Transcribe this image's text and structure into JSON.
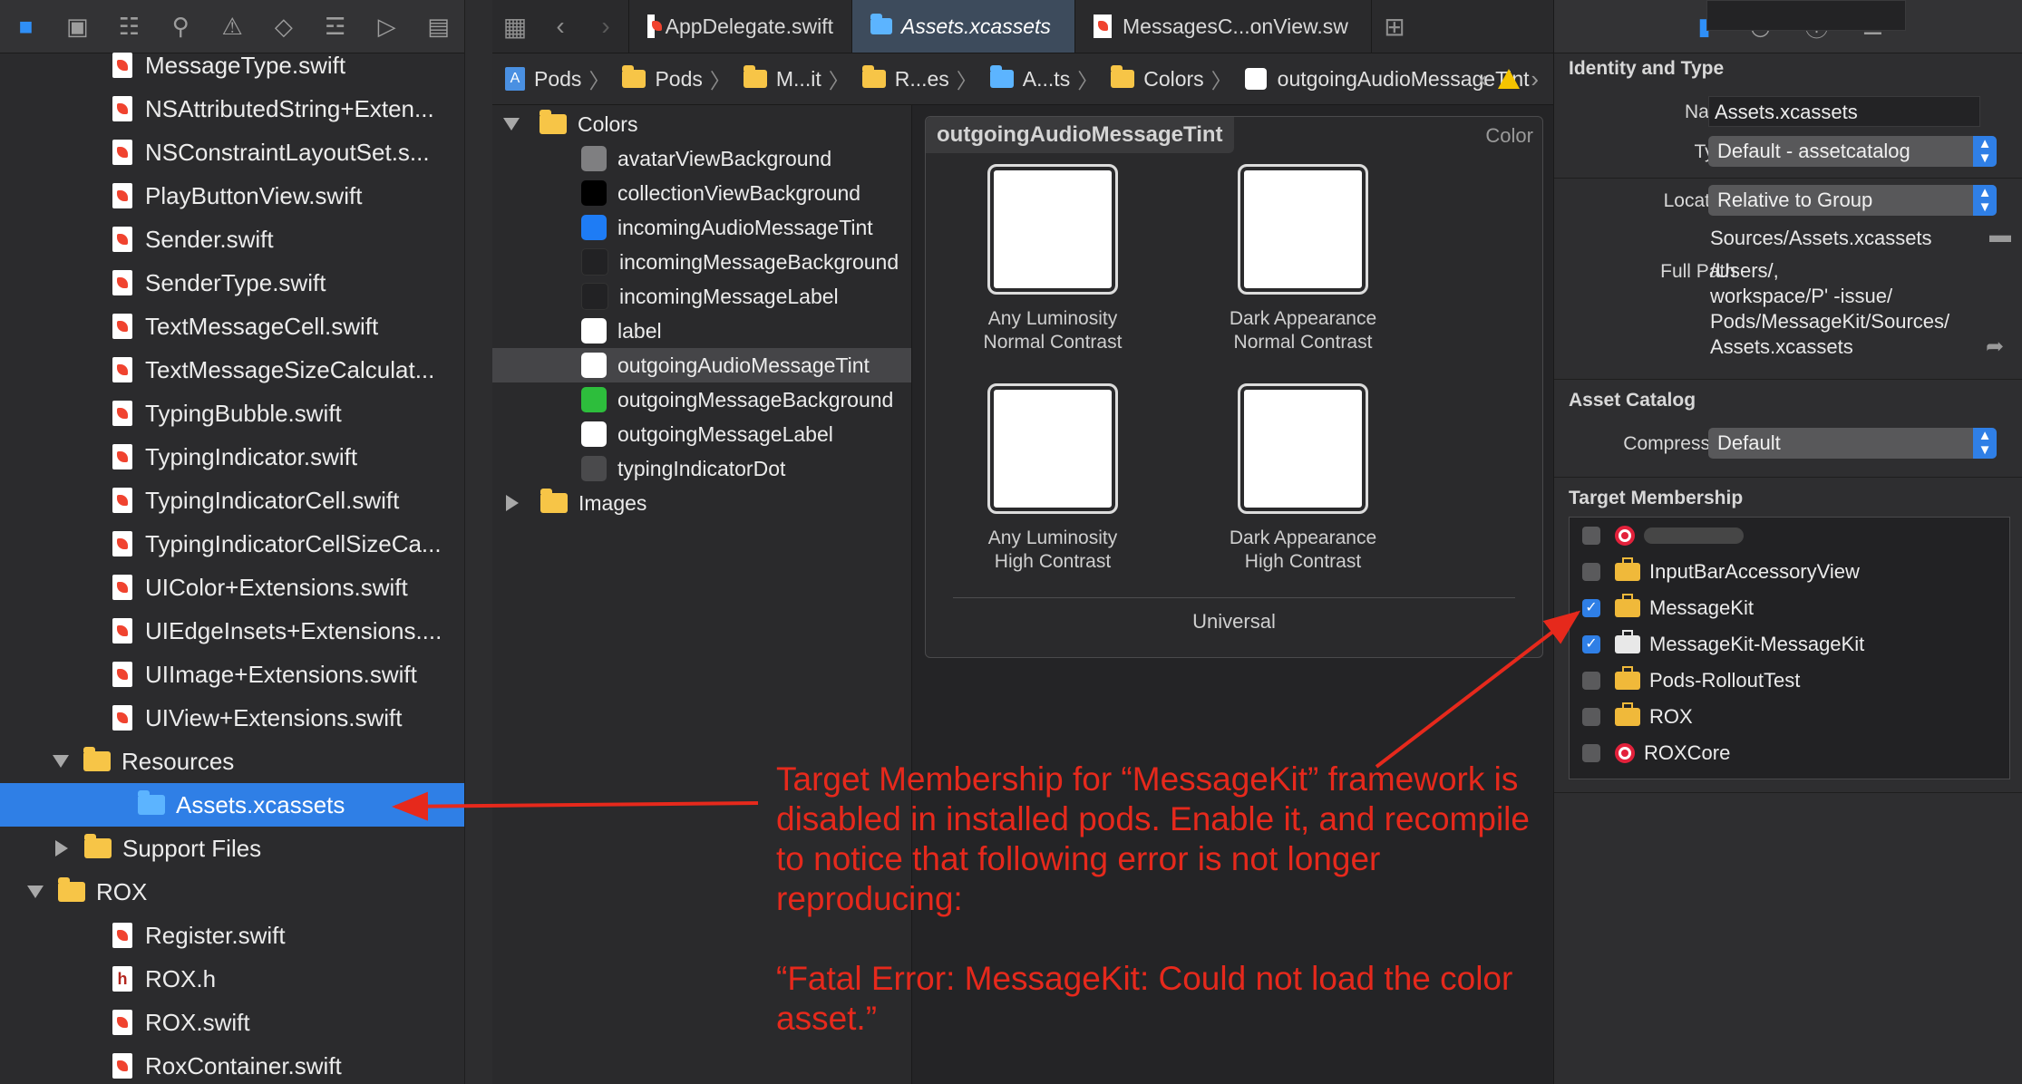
{
  "navigator": {
    "toolbar_icons": [
      "folder-icon",
      "source-control-icon",
      "symbol-icon",
      "find-icon",
      "issue-icon",
      "test-icon",
      "debug-icon",
      "breakpoint-icon",
      "report-icon"
    ],
    "items": [
      {
        "label": "MessageType.swift",
        "kind": "swift",
        "indent": 1
      },
      {
        "label": "NSAttributedString+Exten...",
        "kind": "swift",
        "indent": 1
      },
      {
        "label": "NSConstraintLayoutSet.s...",
        "kind": "swift",
        "indent": 1
      },
      {
        "label": "PlayButtonView.swift",
        "kind": "swift",
        "indent": 1
      },
      {
        "label": "Sender.swift",
        "kind": "swift",
        "indent": 1
      },
      {
        "label": "SenderType.swift",
        "kind": "swift",
        "indent": 1
      },
      {
        "label": "TextMessageCell.swift",
        "kind": "swift",
        "indent": 1
      },
      {
        "label": "TextMessageSizeCalculat...",
        "kind": "swift",
        "indent": 1
      },
      {
        "label": "TypingBubble.swift",
        "kind": "swift",
        "indent": 1
      },
      {
        "label": "TypingIndicator.swift",
        "kind": "swift",
        "indent": 1
      },
      {
        "label": "TypingIndicatorCell.swift",
        "kind": "swift",
        "indent": 1
      },
      {
        "label": "TypingIndicatorCellSizeCa...",
        "kind": "swift",
        "indent": 1
      },
      {
        "label": "UIColor+Extensions.swift",
        "kind": "swift",
        "indent": 1
      },
      {
        "label": "UIEdgeInsets+Extensions....",
        "kind": "swift",
        "indent": 1
      },
      {
        "label": "UIImage+Extensions.swift",
        "kind": "swift",
        "indent": 1
      },
      {
        "label": "UIView+Extensions.swift",
        "kind": "swift",
        "indent": 1
      },
      {
        "label": "Resources",
        "kind": "folder-open",
        "indent": 0
      },
      {
        "label": "Assets.xcassets",
        "kind": "assets",
        "indent": 2,
        "selected": true
      },
      {
        "label": "Support Files",
        "kind": "folder-closed",
        "indent": 0
      },
      {
        "label": "ROX",
        "kind": "folder-open",
        "indent": -1
      },
      {
        "label": "Register.swift",
        "kind": "swift",
        "indent": 1
      },
      {
        "label": "ROX.h",
        "kind": "header",
        "indent": 1
      },
      {
        "label": "ROX.swift",
        "kind": "swift",
        "indent": 1
      },
      {
        "label": "RoxContainer.swift",
        "kind": "swift",
        "indent": 1
      }
    ]
  },
  "editor": {
    "tabs": [
      {
        "label": "AppDelegate.swift",
        "active": false
      },
      {
        "label": "Assets.xcassets",
        "active": true
      },
      {
        "label": "MessagesC...onView.sw",
        "active": false
      }
    ],
    "breadcrumbs": [
      "Pods",
      "Pods",
      "M...it",
      "R...es",
      "A...ts",
      "Colors",
      "outgoingAudioMessageTint"
    ]
  },
  "asset_outline": {
    "colors_folder": "Colors",
    "images_folder": "Images",
    "colors": [
      {
        "name": "avatarViewBackground",
        "swatch": "#7f7f81"
      },
      {
        "name": "collectionViewBackground",
        "swatch": "#000000"
      },
      {
        "name": "incomingAudioMessageTint",
        "swatch": "#1e7cf5"
      },
      {
        "name": "incomingMessageBackground",
        "swatch": "#222224"
      },
      {
        "name": "incomingMessageLabel",
        "swatch": "#222224"
      },
      {
        "name": "label",
        "swatch": "#ffffff"
      },
      {
        "name": "outgoingAudioMessageTint",
        "swatch": "#ffffff",
        "selected": true
      },
      {
        "name": "outgoingMessageBackground",
        "swatch": "#2dbe3c"
      },
      {
        "name": "outgoingMessageLabel",
        "swatch": "#ffffff"
      },
      {
        "name": "typingIndicatorDot",
        "swatch": "#4a4a4c"
      }
    ]
  },
  "canvas": {
    "color_set_name": "outgoingAudioMessageTint",
    "color_set_type": "Color",
    "wells": [
      {
        "line1": "Any Luminosity",
        "line2": "Normal Contrast"
      },
      {
        "line1": "Dark Appearance",
        "line2": "Normal Contrast"
      },
      {
        "line1": "Any Luminosity",
        "line2": "High Contrast"
      },
      {
        "line1": "Dark Appearance",
        "line2": "High Contrast"
      }
    ],
    "universal_label": "Universal"
  },
  "inspector": {
    "identity_title": "Identity and Type",
    "name_label": "Name",
    "name_value": "Assets.xcassets",
    "type_label": "Type",
    "type_value": "Default - assetcatalog",
    "location_label": "Location",
    "location_value": "Relative to Group",
    "location_path": "Sources/Assets.xcassets",
    "fullpath_label": "Full Path",
    "fullpath_lines": [
      "/Users/,",
      "workspace/P'         -issue/",
      "Pods/MessageKit/Sources/",
      "Assets.xcassets"
    ],
    "asset_catalog_title": "Asset Catalog",
    "compression_label": "Compression",
    "compression_value": "Default",
    "membership_title": "Target Membership",
    "targets": [
      {
        "name": "",
        "icon": "target",
        "checked": false,
        "blurred": true
      },
      {
        "name": "InputBarAccessoryView",
        "icon": "toolbox",
        "checked": false
      },
      {
        "name": "MessageKit",
        "icon": "toolbox",
        "checked": true
      },
      {
        "name": "MessageKit-MessageKit",
        "icon": "toolbox-white",
        "checked": true
      },
      {
        "name": "Pods-RolloutTest",
        "icon": "toolbox",
        "checked": false
      },
      {
        "name": "ROX",
        "icon": "toolbox",
        "checked": false
      },
      {
        "name": "ROXCore",
        "icon": "target",
        "checked": false
      }
    ]
  },
  "annotation": {
    "text": "Target Membership for “MessageKit” framework is disabled in installed pods. Enable it, and recompile to notice that following error is not longer reproducing:\n\n“Fatal Error: MessageKit: Could not load the color asset.”",
    "color": "#e6291c"
  }
}
